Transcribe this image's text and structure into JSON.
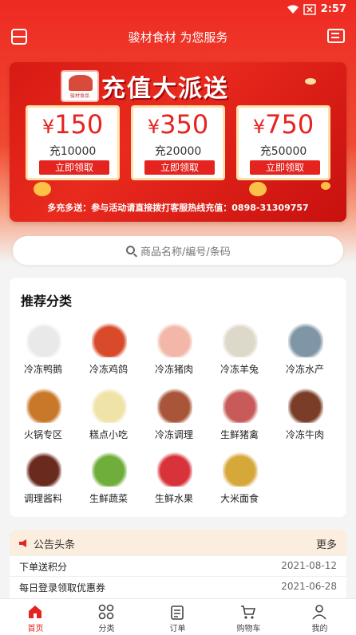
{
  "status_bar": {
    "time": "2:57"
  },
  "header": {
    "title": "骏材食材 为您服务"
  },
  "banner": {
    "logo_text": "骏材食品",
    "headline": "充值大派送",
    "coupons": [
      {
        "price": "150",
        "sub": "充10000",
        "claim": "立即领取"
      },
      {
        "price": "350",
        "sub": "充20000",
        "claim": "立即领取"
      },
      {
        "price": "750",
        "sub": "充50000",
        "claim": "立即领取"
      }
    ],
    "footer": "多充多送：参与活动请直接拨打客服热线充值：0898-31309757"
  },
  "search": {
    "placeholder": "商品名称/编号/条码"
  },
  "categories": {
    "title": "推荐分类",
    "items": [
      {
        "label": "冷冻鸭鹅",
        "icon": "duck-icon",
        "color": "#e9e9e9"
      },
      {
        "label": "冷冻鸡鸽",
        "icon": "rooster-icon",
        "color": "#d84a2a"
      },
      {
        "label": "冷冻猪肉",
        "icon": "pig-icon",
        "color": "#f2b7a8"
      },
      {
        "label": "冷冻羊兔",
        "icon": "sheep-icon",
        "color": "#ddd8c9"
      },
      {
        "label": "冷冻水产",
        "icon": "fish-icon",
        "color": "#7f96a6"
      },
      {
        "label": "火锅专区",
        "icon": "hotpot-icon",
        "color": "#c9782a"
      },
      {
        "label": "糕点小吃",
        "icon": "pastry-icon",
        "color": "#f0e3a8"
      },
      {
        "label": "冷冻调理",
        "icon": "skewer-icon",
        "color": "#a8553a"
      },
      {
        "label": "生鲜猪禽",
        "icon": "meat-platter-icon",
        "color": "#c95a5a"
      },
      {
        "label": "冷冻牛肉",
        "icon": "cow-icon",
        "color": "#7a3e28"
      },
      {
        "label": "调理酱料",
        "icon": "sauce-bottles-icon",
        "color": "#6b2a1e"
      },
      {
        "label": "生鲜蔬菜",
        "icon": "cabbage-icon",
        "color": "#6fae3a"
      },
      {
        "label": "生鲜水果",
        "icon": "strawberry-icon",
        "color": "#d8333a"
      },
      {
        "label": "大米面食",
        "icon": "wheat-icon",
        "color": "#d6a83a"
      }
    ]
  },
  "notice": {
    "title": "公告头条",
    "more": "更多",
    "rows": [
      {
        "text": "下单送积分",
        "date": "2021-08-12"
      },
      {
        "text": "每日登录领取优惠券",
        "date": "2021-06-28"
      }
    ]
  },
  "tabbar": {
    "tabs": [
      {
        "label": "首页",
        "active": true
      },
      {
        "label": "分类"
      },
      {
        "label": "订单"
      },
      {
        "label": "购物车"
      },
      {
        "label": "我的"
      }
    ]
  },
  "colors": {
    "brand": "#e52420",
    "banner_bg": "#d71a14",
    "notice_bg": "#fbeede"
  }
}
